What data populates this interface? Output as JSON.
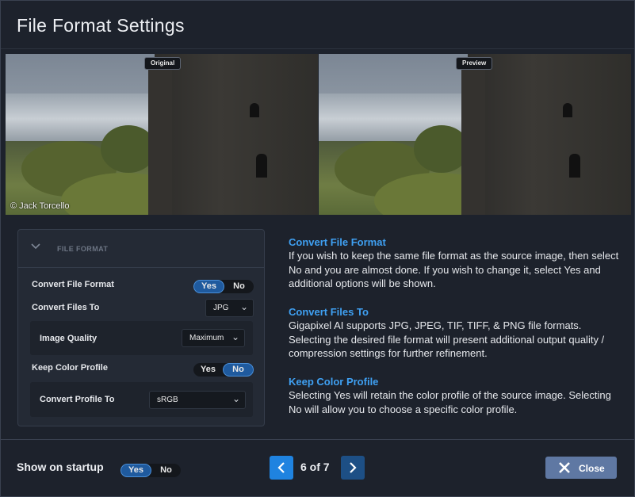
{
  "dialog": {
    "title": "File Format Settings"
  },
  "previews": {
    "original_badge": "Original",
    "preview_badge": "Preview",
    "credit": "© Jack Torcello"
  },
  "panel": {
    "header": "FILE FORMAT",
    "convert_format": {
      "label": "Convert File Format",
      "yes": "Yes",
      "no": "No",
      "selected": "Yes"
    },
    "convert_to": {
      "label": "Convert Files To",
      "value": "JPG"
    },
    "image_quality": {
      "label": "Image Quality",
      "value": "Maximum"
    },
    "keep_profile": {
      "label": "Keep Color Profile",
      "yes": "Yes",
      "no": "No",
      "selected": "No"
    },
    "convert_profile": {
      "label": "Convert Profile To",
      "value": "sRGB"
    }
  },
  "help": [
    {
      "heading": "Convert File Format",
      "body": "If you wish to keep the same file format as the source image, then select No and you are almost done. If you wish to change it, select Yes and additional options will be shown."
    },
    {
      "heading": "Convert Files To",
      "body": "Gigapixel AI supports JPG, JPEG, TIF, TIFF, & PNG file formats. Selecting the desired file format will present additional output quality / compression settings for further refinement."
    },
    {
      "heading": "Keep Color Profile",
      "body": "Selecting Yes will retain the color profile of the source image. Selecting No will allow you to choose a specific color profile."
    }
  ],
  "footer": {
    "startup_label": "Show on startup",
    "startup_yes": "Yes",
    "startup_no": "No",
    "startup_selected": "Yes",
    "pager": "6 of 7",
    "prev_icon": "chevron-left-icon",
    "next_icon": "chevron-right-icon",
    "close_label": "Close",
    "close_icon": "close-icon"
  },
  "colors": {
    "background": "#1d222c",
    "accent": "#1f83e0",
    "help_heading": "#3fa0f2",
    "close_button": "#5f78a3"
  }
}
